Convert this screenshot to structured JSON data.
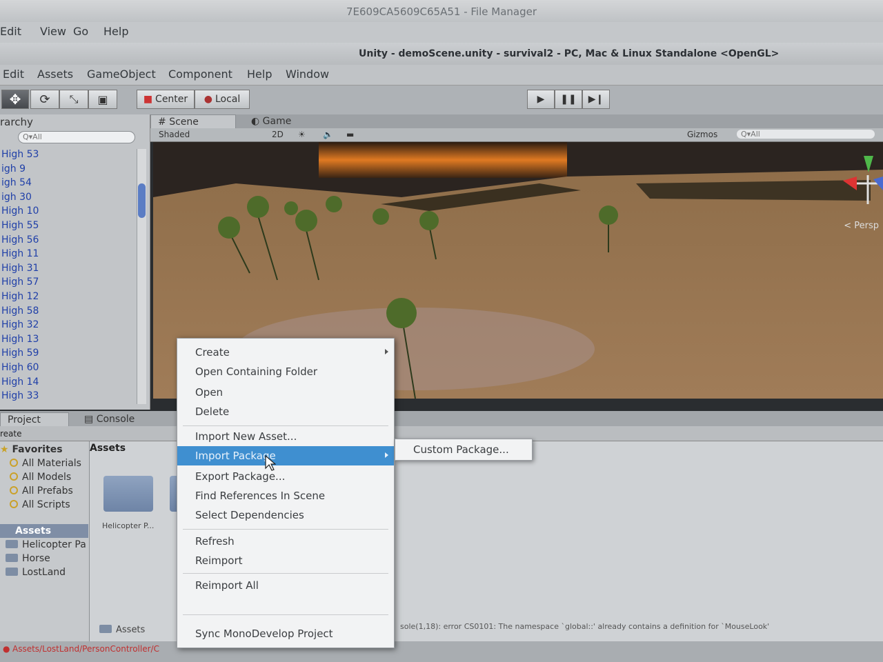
{
  "file_manager": {
    "title": "7E609CA5609C65A51 - File Manager",
    "menu": [
      "Edit",
      "View",
      "Go",
      "Help"
    ]
  },
  "unity": {
    "title": "Unity - demoScene.unity - survival2 - PC, Mac & Linux Standalone <OpenGL>",
    "menu": [
      "Edit",
      "Assets",
      "GameObject",
      "Component",
      "Help",
      "Window"
    ]
  },
  "toolbar": {
    "center_label": "Center",
    "local_label": "Local"
  },
  "hierarchy": {
    "tab_label": "rarchy",
    "search_placeholder": "Q▾All",
    "items": [
      "High 53",
      "igh 9",
      "igh 54",
      "igh 30",
      "High 10",
      "High 55",
      "High 56",
      "High 11",
      "High 31",
      "High 57",
      "High 12",
      "High 58",
      "High 32",
      "High 13",
      "High 59",
      "High 60",
      "High 14",
      "High 33"
    ]
  },
  "scene": {
    "tabs": [
      "Scene",
      "Game"
    ],
    "shading_mode": "Shaded",
    "mode_2d": "2D",
    "gizmos_label": "Gizmos",
    "search_placeholder": "Q▾All",
    "persp_label": "< Persp"
  },
  "project": {
    "tabs": [
      "Project",
      "Console"
    ],
    "create_label": "reate",
    "breadcrumb": "Assets",
    "favorites_label": "Favorites",
    "favorites": [
      "All Materials",
      "All Models",
      "All Prefabs",
      "All Scripts"
    ],
    "assets_label": "Assets",
    "folders": [
      "Helicopter Pa",
      "Horse",
      "LostLand"
    ],
    "grid_item": "Helicopter P...",
    "footer_path": "Assets"
  },
  "status": {
    "message": "Assets/LostLand/PersonController/C",
    "message_right": "sole(1,18): error CS0101: The namespace `global::' already contains a definition for `MouseLook'"
  },
  "context_menu": {
    "items": [
      "Create",
      "Open Containing Folder",
      "Open",
      "Delete",
      "Import New Asset...",
      "Import Package",
      "Export Package...",
      "Find References In Scene",
      "Select Dependencies",
      "Refresh",
      "Reimport",
      "Reimport All",
      "Sync MonoDevelop Project"
    ],
    "highlighted": "Import Package",
    "submenu_item": "Custom Package..."
  },
  "colors": {
    "highlight": "#3f8fd0",
    "hierarchy_text": "#1f3fa8",
    "sky": "#e07a22"
  }
}
